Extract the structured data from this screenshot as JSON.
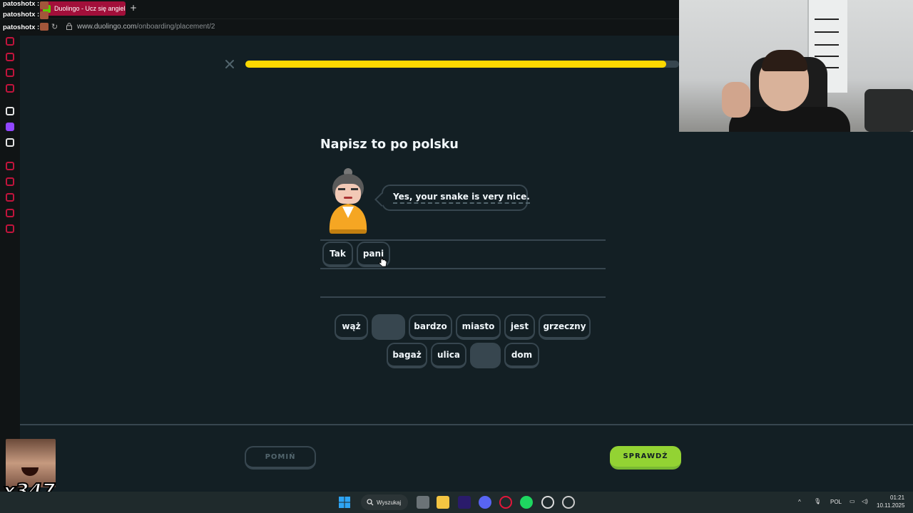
{
  "browser": {
    "tab_title": "Duolingo - Ucz się angielsk",
    "new_tab": "+",
    "url_host": "www.duolingo.com",
    "url_path": "/onboarding/placement/2"
  },
  "chat_overlay": {
    "names": [
      "patoshotx :",
      "patoshotx :",
      "patoshotx :"
    ]
  },
  "lesson": {
    "progress_fraction": 0.97,
    "prompt": "Napisz to po polsku",
    "sentence": "Yes, your snake is very nice.",
    "answer_tiles": [
      "Tak",
      "pani"
    ],
    "word_bank_row1": [
      "wąż",
      "",
      "bardzo",
      "miasto",
      "jest",
      "grzeczny"
    ],
    "word_bank_row2": [
      "bagaż",
      "ulica",
      "",
      "dom"
    ],
    "skip_label": "POMIŃ",
    "check_label": "SPRAWDŹ"
  },
  "stream_overlay": {
    "emote_count": "x347"
  },
  "taskbar": {
    "search_label": "Wyszukaj",
    "language": "POL",
    "time": "01:21",
    "date": "10.11.2025"
  },
  "colors": {
    "background": "#131f24",
    "progress": "#fcd800",
    "check_button": "#93d333",
    "border": "#37464f",
    "tab_active": "#a20f3a"
  }
}
